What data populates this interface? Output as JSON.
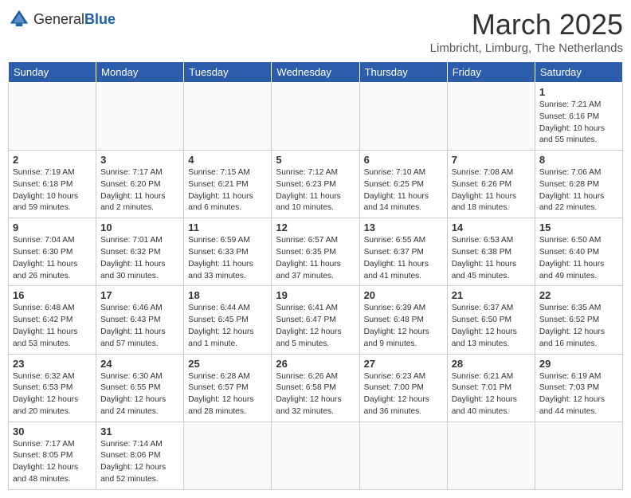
{
  "header": {
    "logo_general": "General",
    "logo_blue": "Blue",
    "month_title": "March 2025",
    "subtitle": "Limbricht, Limburg, The Netherlands"
  },
  "weekdays": [
    "Sunday",
    "Monday",
    "Tuesday",
    "Wednesday",
    "Thursday",
    "Friday",
    "Saturday"
  ],
  "weeks": [
    [
      {
        "day": "",
        "info": ""
      },
      {
        "day": "",
        "info": ""
      },
      {
        "day": "",
        "info": ""
      },
      {
        "day": "",
        "info": ""
      },
      {
        "day": "",
        "info": ""
      },
      {
        "day": "",
        "info": ""
      },
      {
        "day": "1",
        "info": "Sunrise: 7:21 AM\nSunset: 6:16 PM\nDaylight: 10 hours\nand 55 minutes."
      }
    ],
    [
      {
        "day": "2",
        "info": "Sunrise: 7:19 AM\nSunset: 6:18 PM\nDaylight: 10 hours\nand 59 minutes."
      },
      {
        "day": "3",
        "info": "Sunrise: 7:17 AM\nSunset: 6:20 PM\nDaylight: 11 hours\nand 2 minutes."
      },
      {
        "day": "4",
        "info": "Sunrise: 7:15 AM\nSunset: 6:21 PM\nDaylight: 11 hours\nand 6 minutes."
      },
      {
        "day": "5",
        "info": "Sunrise: 7:12 AM\nSunset: 6:23 PM\nDaylight: 11 hours\nand 10 minutes."
      },
      {
        "day": "6",
        "info": "Sunrise: 7:10 AM\nSunset: 6:25 PM\nDaylight: 11 hours\nand 14 minutes."
      },
      {
        "day": "7",
        "info": "Sunrise: 7:08 AM\nSunset: 6:26 PM\nDaylight: 11 hours\nand 18 minutes."
      },
      {
        "day": "8",
        "info": "Sunrise: 7:06 AM\nSunset: 6:28 PM\nDaylight: 11 hours\nand 22 minutes."
      }
    ],
    [
      {
        "day": "9",
        "info": "Sunrise: 7:04 AM\nSunset: 6:30 PM\nDaylight: 11 hours\nand 26 minutes."
      },
      {
        "day": "10",
        "info": "Sunrise: 7:01 AM\nSunset: 6:32 PM\nDaylight: 11 hours\nand 30 minutes."
      },
      {
        "day": "11",
        "info": "Sunrise: 6:59 AM\nSunset: 6:33 PM\nDaylight: 11 hours\nand 33 minutes."
      },
      {
        "day": "12",
        "info": "Sunrise: 6:57 AM\nSunset: 6:35 PM\nDaylight: 11 hours\nand 37 minutes."
      },
      {
        "day": "13",
        "info": "Sunrise: 6:55 AM\nSunset: 6:37 PM\nDaylight: 11 hours\nand 41 minutes."
      },
      {
        "day": "14",
        "info": "Sunrise: 6:53 AM\nSunset: 6:38 PM\nDaylight: 11 hours\nand 45 minutes."
      },
      {
        "day": "15",
        "info": "Sunrise: 6:50 AM\nSunset: 6:40 PM\nDaylight: 11 hours\nand 49 minutes."
      }
    ],
    [
      {
        "day": "16",
        "info": "Sunrise: 6:48 AM\nSunset: 6:42 PM\nDaylight: 11 hours\nand 53 minutes."
      },
      {
        "day": "17",
        "info": "Sunrise: 6:46 AM\nSunset: 6:43 PM\nDaylight: 11 hours\nand 57 minutes."
      },
      {
        "day": "18",
        "info": "Sunrise: 6:44 AM\nSunset: 6:45 PM\nDaylight: 12 hours\nand 1 minute."
      },
      {
        "day": "19",
        "info": "Sunrise: 6:41 AM\nSunset: 6:47 PM\nDaylight: 12 hours\nand 5 minutes."
      },
      {
        "day": "20",
        "info": "Sunrise: 6:39 AM\nSunset: 6:48 PM\nDaylight: 12 hours\nand 9 minutes."
      },
      {
        "day": "21",
        "info": "Sunrise: 6:37 AM\nSunset: 6:50 PM\nDaylight: 12 hours\nand 13 minutes."
      },
      {
        "day": "22",
        "info": "Sunrise: 6:35 AM\nSunset: 6:52 PM\nDaylight: 12 hours\nand 16 minutes."
      }
    ],
    [
      {
        "day": "23",
        "info": "Sunrise: 6:32 AM\nSunset: 6:53 PM\nDaylight: 12 hours\nand 20 minutes."
      },
      {
        "day": "24",
        "info": "Sunrise: 6:30 AM\nSunset: 6:55 PM\nDaylight: 12 hours\nand 24 minutes."
      },
      {
        "day": "25",
        "info": "Sunrise: 6:28 AM\nSunset: 6:57 PM\nDaylight: 12 hours\nand 28 minutes."
      },
      {
        "day": "26",
        "info": "Sunrise: 6:26 AM\nSunset: 6:58 PM\nDaylight: 12 hours\nand 32 minutes."
      },
      {
        "day": "27",
        "info": "Sunrise: 6:23 AM\nSunset: 7:00 PM\nDaylight: 12 hours\nand 36 minutes."
      },
      {
        "day": "28",
        "info": "Sunrise: 6:21 AM\nSunset: 7:01 PM\nDaylight: 12 hours\nand 40 minutes."
      },
      {
        "day": "29",
        "info": "Sunrise: 6:19 AM\nSunset: 7:03 PM\nDaylight: 12 hours\nand 44 minutes."
      }
    ],
    [
      {
        "day": "30",
        "info": "Sunrise: 7:17 AM\nSunset: 8:05 PM\nDaylight: 12 hours\nand 48 minutes."
      },
      {
        "day": "31",
        "info": "Sunrise: 7:14 AM\nSunset: 8:06 PM\nDaylight: 12 hours\nand 52 minutes."
      },
      {
        "day": "",
        "info": ""
      },
      {
        "day": "",
        "info": ""
      },
      {
        "day": "",
        "info": ""
      },
      {
        "day": "",
        "info": ""
      },
      {
        "day": "",
        "info": ""
      }
    ]
  ]
}
